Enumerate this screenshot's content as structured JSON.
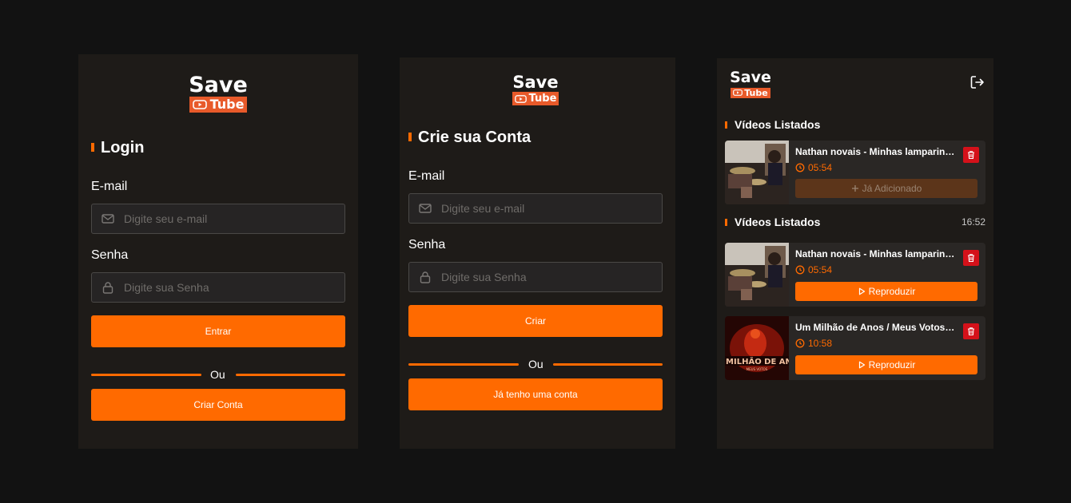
{
  "logo": {
    "save": "Save",
    "tube": "Tube"
  },
  "login": {
    "title": "Login",
    "email_label": "E-mail",
    "email_placeholder": "Digite seu e-mail",
    "password_label": "Senha",
    "password_placeholder": "Digite sua Senha",
    "submit_label": "Entrar",
    "divider_text": "Ou",
    "secondary_label": "Criar Conta"
  },
  "signup": {
    "title": "Crie sua Conta",
    "email_label": "E-mail",
    "email_placeholder": "Digite seu e-mail",
    "password_label": "Senha",
    "password_placeholder": "Digite sua Senha",
    "submit_label": "Criar",
    "divider_text": "Ou",
    "secondary_label": "Já tenho uma conta"
  },
  "videos": {
    "header_icon": "logout-icon",
    "section1": {
      "title": "Vídeos Listados",
      "items": [
        {
          "title": "Nathan novais - Minhas lamparinas...",
          "duration": "05:54",
          "action": "Já Adicionado"
        }
      ]
    },
    "section2": {
      "title": "Vídeos Listados",
      "time": "16:52",
      "items": [
        {
          "title": "Nathan novais - Minhas lamparinas...",
          "duration": "05:54",
          "action": "Reproduzir"
        },
        {
          "title": "Um Milhão de Anos / Meus Votos - ...",
          "duration": "10:58",
          "action": "Reproduzir"
        }
      ]
    }
  },
  "colors": {
    "accent": "#ff6a00",
    "panel": "#1e1b18",
    "background": "#121212",
    "delete": "#d4111a",
    "logo_badge": "#e85a2a"
  }
}
